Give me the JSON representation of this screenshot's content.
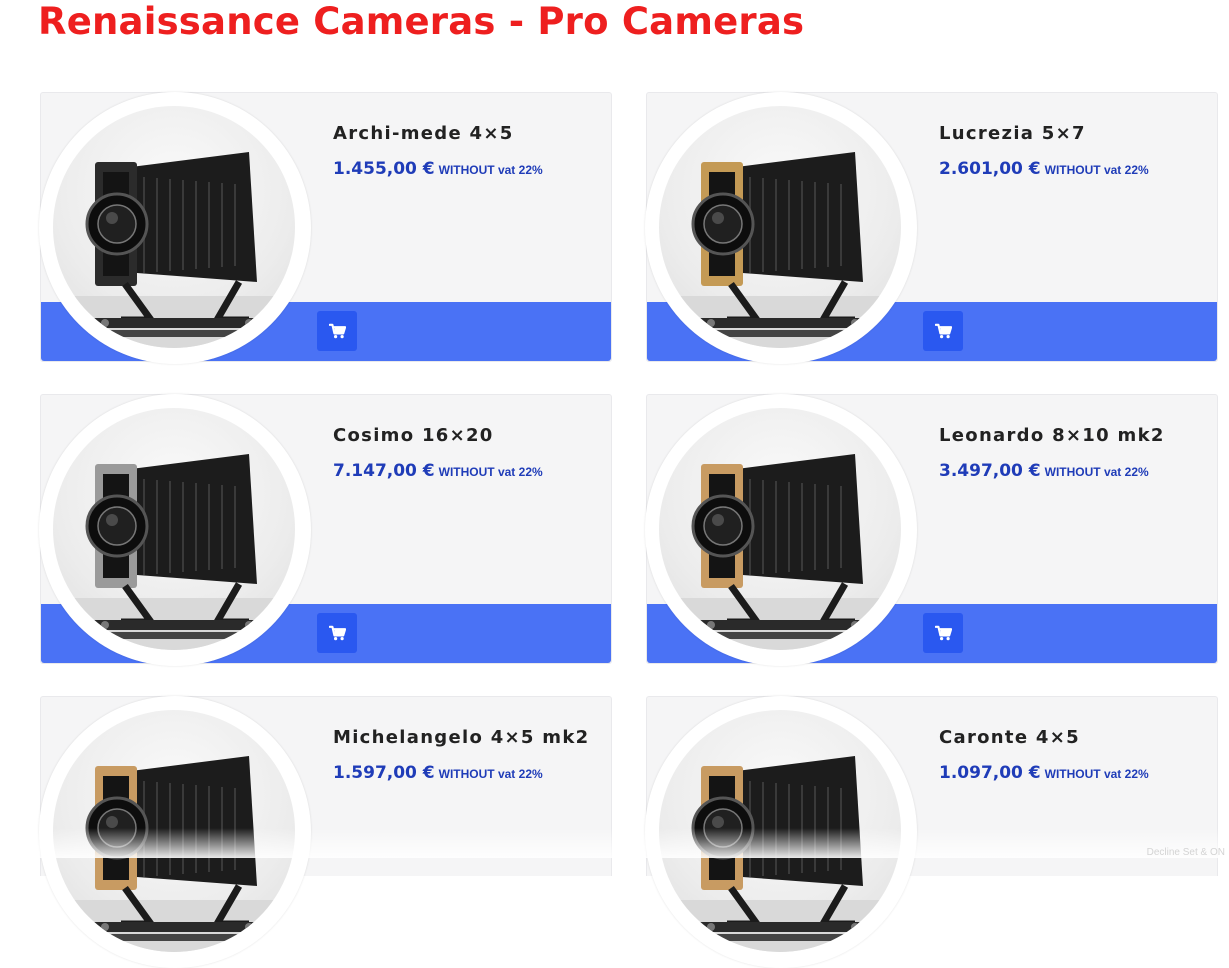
{
  "header": {
    "title": "Renaissance Cameras - Pro Cameras",
    "title_color": "#ee1f1f"
  },
  "theme": {
    "accent": "#4a72f5",
    "button": "#2a58f0",
    "price_color": "#1f3cb8"
  },
  "icons": {
    "cart": "shopping-cart-icon"
  },
  "products": [
    {
      "name": "Archi-mede 4×5",
      "price": "1.455,00 €",
      "vat_note": "WITHOUT vat 22%",
      "frame": "black"
    },
    {
      "name": "Lucrezia 5×7",
      "price": "2.601,00 €",
      "vat_note": "WITHOUT vat 22%",
      "frame": "gold"
    },
    {
      "name": "Cosimo 16×20",
      "price": "7.147,00 €",
      "vat_note": "WITHOUT vat 22%",
      "frame": "silver"
    },
    {
      "name": "Leonardo 8×10 mk2",
      "price": "3.497,00 €",
      "vat_note": "WITHOUT vat 22%",
      "frame": "wood"
    },
    {
      "name": "Michelangelo 4×5 mk2",
      "price": "1.597,00 €",
      "vat_note": "WITHOUT vat 22%",
      "frame": "wood"
    },
    {
      "name": "Caronte 4×5",
      "price": "1.097,00 €",
      "vat_note": "WITHOUT vat 22%",
      "frame": "wood"
    }
  ],
  "watermark": "Decline Set & ON"
}
